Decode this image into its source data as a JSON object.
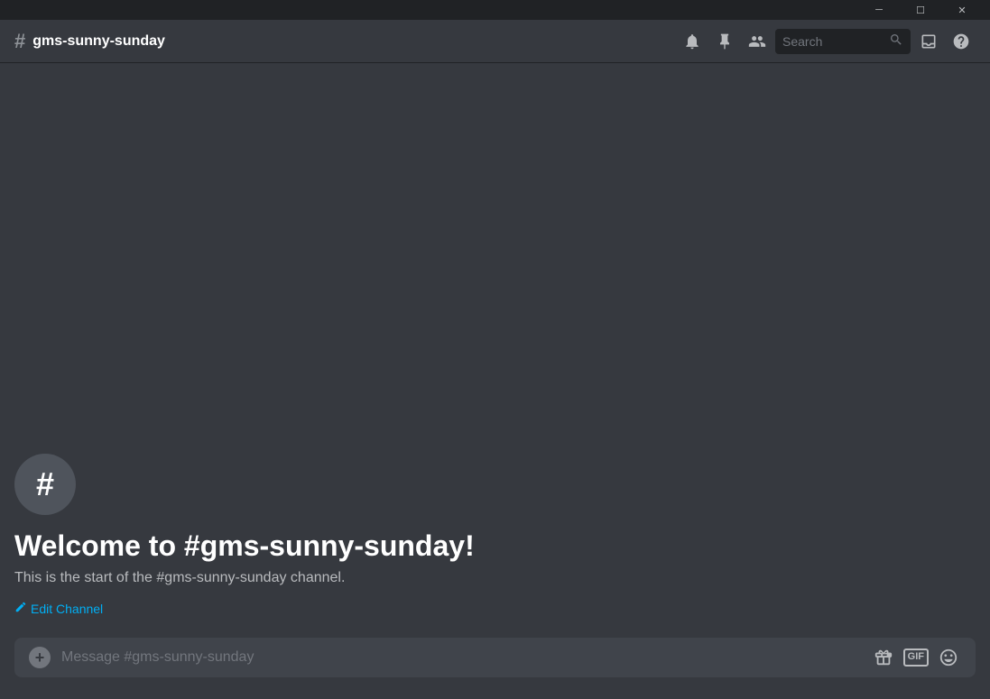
{
  "titlebar": {
    "minimize_label": "─",
    "maximize_label": "☐",
    "close_label": "✕"
  },
  "header": {
    "channel_name": "gms-sunny-sunday",
    "hash_symbol": "#",
    "search_placeholder": "Search"
  },
  "welcome": {
    "hash_symbol": "#",
    "title": "Welcome to #gms-sunny-sunday!",
    "subtitle": "This is the start of the #gms-sunny-sunday channel.",
    "edit_channel_label": "Edit Channel"
  },
  "message_input": {
    "placeholder": "Message #gms-sunny-sunday",
    "add_icon": "+",
    "gift_tooltip": "Send a Gift",
    "gif_label": "GIF",
    "emoji_tooltip": "Emoji"
  },
  "colors": {
    "background": "#36393f",
    "dark_bg": "#202225",
    "medium_bg": "#2f3136",
    "input_bg": "#40444b",
    "text_primary": "#ffffff",
    "text_secondary": "#b9bbbe",
    "text_muted": "#72767d",
    "accent_blue": "#00aff4",
    "icon_gray": "#8e9297"
  }
}
